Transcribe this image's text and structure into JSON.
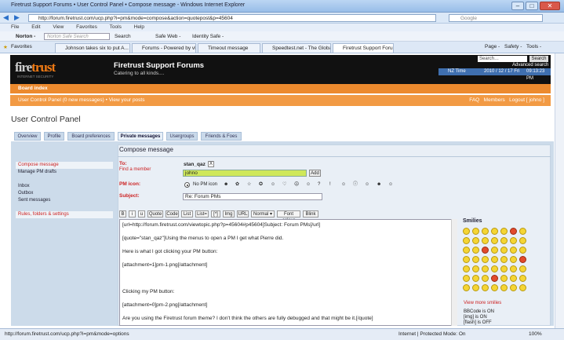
{
  "window": {
    "title": "Firetrust Support Forums • User Control Panel • Compose message - Windows Internet Explorer",
    "min": "–",
    "max": "□",
    "close": "✕"
  },
  "address": {
    "url": "http://forum.firetrust.com/ucp.php?i=pm&mode=compose&action=quotepost&p=45604",
    "search_placeholder": "Google"
  },
  "menu": [
    "File",
    "Edit",
    "View",
    "Favorites",
    "Tools",
    "Help"
  ],
  "norton": {
    "brand": "Norton -",
    "search_placeholder": "Norton Safe Search",
    "search_btn": "Search",
    "safe_web": "Safe Web -",
    "identity_safe": "Identity Safe -"
  },
  "favorites": {
    "label": "Favorites",
    "tabs": [
      "Johnson takes six to put A...",
      "Forums - Powered by vBu...",
      "Timeout message",
      "Speedtest.net - The Globa...",
      "Firetrust Support Foru..."
    ],
    "right": [
      "Page -",
      "Safety -",
      "Tools -"
    ]
  },
  "banner": {
    "logo_a": "fire",
    "logo_b": "trust",
    "logo_sub": "INTERNET SECURITY",
    "title": "Firetrust Support Forums",
    "tagline": "Catering to all kinds....",
    "search_value": "Search…",
    "search_btn": "Search",
    "advanced": "Advanced search",
    "tz_label": "NZ Time",
    "date": "2010 / 12 / 17 Fri",
    "time": "09:13:23 PM"
  },
  "nav": {
    "board_index": "Board index",
    "ucp_link": "User Control Panel (0 new messages) • View your posts",
    "faq": "FAQ",
    "members": "Members",
    "logout": "Logout [ johno ]"
  },
  "ucp": {
    "title": "User Control Panel",
    "tabs": [
      "Overview",
      "Profile",
      "Board preferences",
      "Private messages",
      "Usergroups",
      "Friends & Foes"
    ],
    "active_tab": 3
  },
  "leftnav": [
    {
      "label": "Compose message",
      "hl": true
    },
    {
      "label": "Manage PM drafts",
      "hl": false
    },
    {
      "label": "",
      "hl": false
    },
    {
      "label": "Inbox",
      "hl": false
    },
    {
      "label": "Outbox",
      "hl": false
    },
    {
      "label": "Sent messages",
      "hl": false
    },
    {
      "label": "",
      "hl": false
    },
    {
      "label": "Rules, folders & settings",
      "hl": true
    }
  ],
  "compose": {
    "heading": "Compose message",
    "to_label": "To:",
    "find_member": "Find a member",
    "recipient": "stan_qaz",
    "remove": "X",
    "member_value": "johno",
    "add_btn": "Add",
    "pm_icon_label": "PM icon:",
    "no_icon": "No PM icon",
    "pm_icons": [
      "☻",
      "✿",
      "☆",
      "✪",
      "☺",
      "♡",
      "☹",
      "☺",
      "?",
      "!",
      "☺",
      "ⓘ",
      "☺",
      "☻",
      "☺"
    ],
    "subject_label": "Subject:",
    "subject_value": "Re: Forum PMs"
  },
  "toolbar": [
    "B",
    "i",
    "u",
    "Quote",
    "Code",
    "List",
    "List=",
    "[*]",
    "Img",
    "URL",
    "Normal ▾",
    "Font colour",
    "Blink"
  ],
  "message_lines": [
    "[url=http://forum.firetrust.com/viewtopic.php?p=45604#p45604]Subject: Forum PMs[/url]",
    "[quote=\"stan_qaz\"]Using the menus to open a PM I get what Pierre did.",
    "Here is what I got clicking your PM button:",
    "[attachment=1]pm-1.png[/attachment]",
    "",
    "Clicking my PM button:",
    "[attachment=0]pm-2.png[/attachment]",
    "Are you using the Firetrust forum theme? I don't think the others are fully debugged and that might be it.[/quote]"
  ],
  "smilies": {
    "label": "Smilies",
    "more": "View more smilies",
    "bbcode": [
      "BBCode is ON",
      "[img] is ON",
      "[flash] is OFF"
    ]
  },
  "status": {
    "url": "http://forum.firetrust.com/ucp.php?i=pm&mode=options",
    "zone": "Internet | Protected Mode: On",
    "zoom": "100%"
  },
  "colors": {
    "orange": "#ec8a2e",
    "banner": "#111111",
    "panel": "#ccdbea",
    "highlight": "#cfe85a"
  }
}
